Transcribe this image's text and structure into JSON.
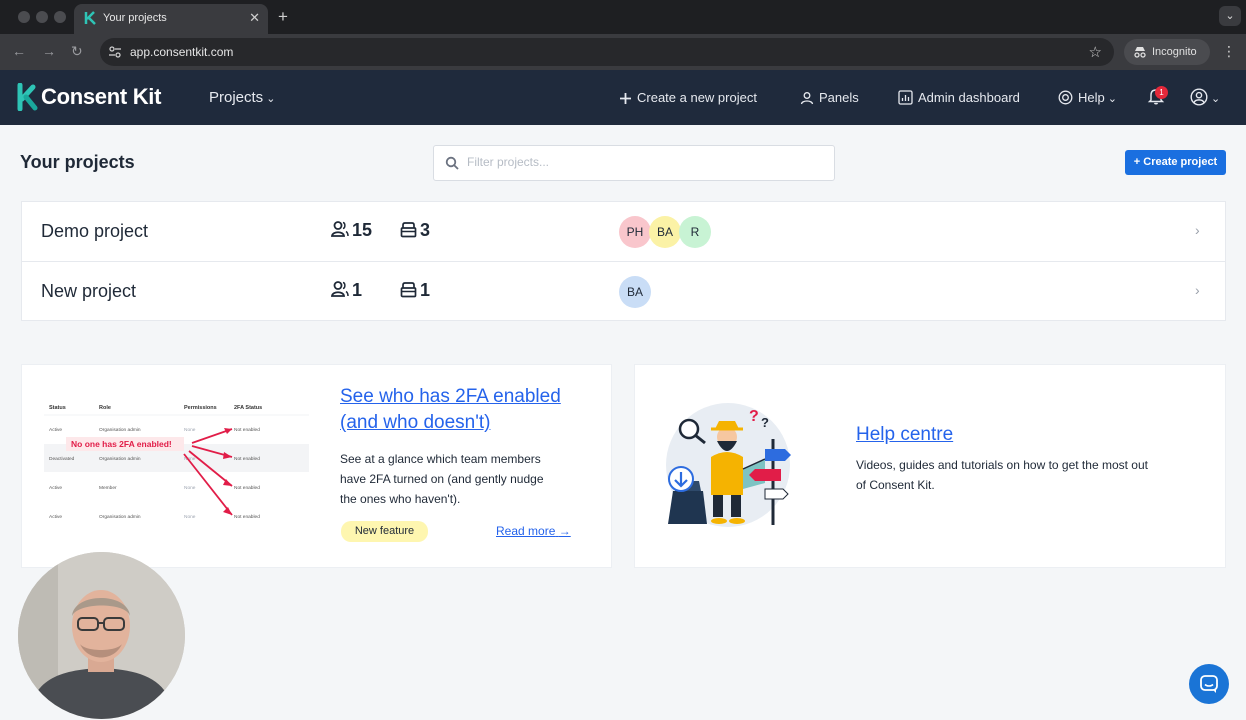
{
  "browser": {
    "tab_title": "Your projects",
    "tab_close_icon": "close-icon",
    "new_tab_icon": "plus-icon",
    "address": "app.consentkit.com",
    "profile_label": "Incognito"
  },
  "header": {
    "brand": "Consent Kit",
    "projects_menu": "Projects",
    "create_project": "Create a new project",
    "panels": "Panels",
    "admin_dashboard": "Admin dashboard",
    "help": "Help",
    "notification_count": "1",
    "colors": {
      "background": "#1f2a3c",
      "brand_teal": "#2ec4b6"
    }
  },
  "page": {
    "title": "Your projects",
    "search_placeholder": "Filter projects...",
    "create_button": "Create project",
    "accent_color": "#1a6fe0"
  },
  "projects": [
    {
      "name": "Demo project",
      "members": "15",
      "panels": "3",
      "avatars": [
        "PH",
        "BA",
        "R"
      ]
    },
    {
      "name": "New project",
      "members": "1",
      "panels": "1",
      "avatars": [
        "BA"
      ]
    }
  ],
  "avatar_colors": {
    "PH": "#f9c6cc",
    "BA": "#fbf2a6",
    "R": "#c8f3d4",
    "BA_blue": "#c9ddf6"
  },
  "cards": {
    "twofa": {
      "title_line1": "See who has 2FA enabled",
      "title_line2": "(and who doesn't)",
      "desc_line1": "See at a glance which team members",
      "desc_line2": "have 2FA turned on (and gently nudge",
      "desc_line3": "the ones who haven't).",
      "badge": "New feature",
      "read_more": "Read more",
      "illustration": {
        "headers": [
          "Status",
          "Role",
          "Permissions",
          "2FA Status"
        ],
        "rows": [
          [
            "Active",
            "Organisation admin",
            "None",
            "Not enabled"
          ],
          [
            "Deactivated",
            "Organisation admin",
            "None",
            "Not enabled"
          ],
          [
            "Active",
            "Member",
            "None",
            "Not enabled"
          ],
          [
            "Active",
            "Organisation admin",
            "None",
            "Not enabled"
          ]
        ],
        "callout": "No one has 2FA enabled!"
      }
    },
    "help": {
      "title": "Help centre",
      "desc_line1": "Videos, guides and tutorials on how to get the most out",
      "desc_line2": "of Consent Kit."
    }
  }
}
